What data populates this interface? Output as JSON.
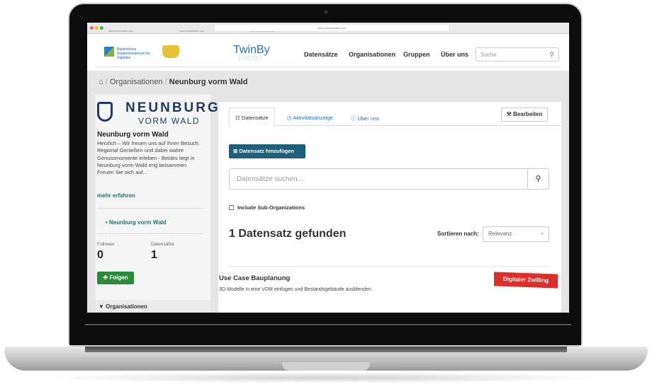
{
  "browser": {
    "url": "www.yourwebsite.com",
    "tabs": [
      "www.yourwebsite.com",
      "www.yourwebsite.com",
      "www.yourwebsite.com"
    ]
  },
  "header": {
    "ministry_label": "Bayerisches Staatsministerium für Digitales",
    "brand": "TwinBy",
    "nav": [
      "Datensätze",
      "Organisationen",
      "Gruppen",
      "Über uns"
    ],
    "search_placeholder": "Suche"
  },
  "breadcrumb": {
    "items": [
      "Organisationen",
      "Neunburg vorm Wald"
    ],
    "separator": "/"
  },
  "sidebar": {
    "logo_name": "NEUNBURG",
    "logo_sub": "VORM WALD",
    "title": "Neunburg vorm Wald",
    "description": "Herzlich – Wir freuen uns auf Ihren Besuch. Regional Genießen und dabei wahre Genussmomente erleben - Beides liegt in Neunburg vorm Wald eng beisammen. Freuen Sie sich auf...",
    "more": "mehr erfahren",
    "org_link": "Neunburg vorm Wald",
    "follower_label": "Follower",
    "follower_count": "0",
    "datasets_label": "Datensätze",
    "datasets_count": "1",
    "follow_button": "Folgen",
    "organisations_heading": "Organisationen"
  },
  "main": {
    "tabs": [
      "Datensätze",
      "Aktivitätsanzeige",
      "Über uns"
    ],
    "edit_button": "Bearbeiten",
    "add_button": "Datensatz hinzufügen",
    "search_placeholder": "Datensätze suchen...",
    "include_sub": "Include Sub-Organizations",
    "result_count": "1 Datensatz gefunden",
    "sort_label": "Sortieren nach:",
    "sort_value": "Relevanz",
    "dataset": {
      "title": "Use Case Bauplanung",
      "description": "3D-Modelle in eine VDM einfügen und Bestandsgebäude ausblenden.",
      "tag": "Digitaler Zwilling"
    }
  },
  "colors": {
    "accent": "#2b6fb3",
    "button_primary": "#1f5e78",
    "follow_green": "#2c8a3c",
    "tag_red": "#d9302c",
    "link_teal": "#2b6f6f"
  }
}
